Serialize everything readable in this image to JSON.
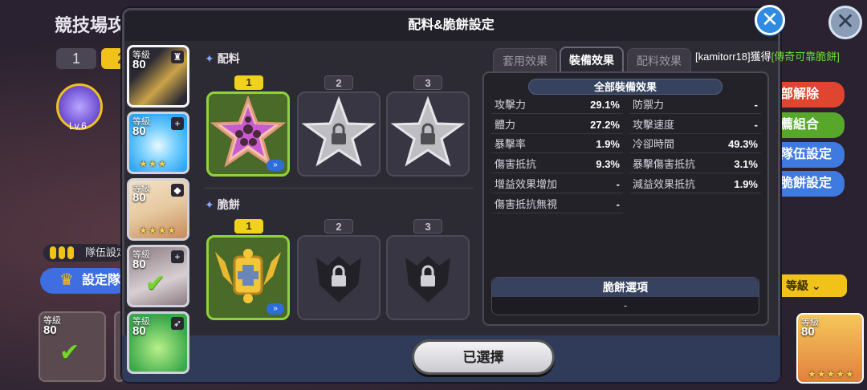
{
  "background": {
    "title": "競技場攻",
    "tabs": [
      "1",
      "2"
    ],
    "badge_level": "Lv.6",
    "team_label": "隊伍設定",
    "set_team_button": "設定隊",
    "right_buttons": [
      "部解除",
      "薦組合",
      "隊伍設定",
      "脆餅設定"
    ],
    "sort_label": "等級",
    "bottom_cookie_level_label": "等級",
    "bottom_cookie_level": "80",
    "close_icon": "close-icon"
  },
  "modal": {
    "title": "配料&脆餅設定",
    "close_label": "✕"
  },
  "cookies": [
    {
      "lv_label": "等級",
      "lv": "80",
      "icon": "sword-cookie",
      "colors": [
        "#2b2a33",
        "#caa34a"
      ],
      "badge": "team-icon"
    },
    {
      "lv_label": "等級",
      "lv": "80",
      "icon": "frost-cookie",
      "colors": [
        "#2fa6f0",
        "#e8f8ff"
      ],
      "stars": "★★★",
      "badge": "+"
    },
    {
      "lv_label": "等級",
      "lv": "80",
      "icon": "cream-cookie",
      "colors": [
        "#f4e2c8",
        "#c98a5a"
      ],
      "stars": "★★★★",
      "badge": "shield"
    },
    {
      "lv_label": "等級",
      "lv": "80",
      "icon": "knight-cookie",
      "colors": [
        "#8a7a80",
        "#d8cfd3"
      ],
      "check": "✔",
      "badge": "+"
    },
    {
      "lv_label": "等級",
      "lv": "80",
      "icon": "forest-cookie",
      "colors": [
        "#3aa84a",
        "#b8f08a"
      ],
      "badge": "arrow"
    }
  ],
  "toppings": {
    "title": "配料",
    "slots": [
      {
        "num": "1",
        "state": "equipped"
      },
      {
        "num": "2",
        "state": "locked"
      },
      {
        "num": "3",
        "state": "locked"
      }
    ]
  },
  "biscuit": {
    "title": "脆餅",
    "slots": [
      {
        "num": "1",
        "state": "equipped"
      },
      {
        "num": "2",
        "state": "locked"
      },
      {
        "num": "3",
        "state": "locked"
      }
    ]
  },
  "tabs": [
    "套用效果",
    "裝備效果",
    "配料效果"
  ],
  "acquire": {
    "user": "[kamitorr18]",
    "verb": "獲得",
    "item": "[傳奇可靠脆餅]"
  },
  "effects": {
    "header": "全部裝備效果",
    "left": [
      {
        "label": "攻擊力",
        "value": "29.1%"
      },
      {
        "label": "體力",
        "value": "27.2%"
      },
      {
        "label": "暴擊率",
        "value": "1.9%"
      },
      {
        "label": "傷害抵抗",
        "value": "9.3%"
      },
      {
        "label": "增益效果增加",
        "value": "-"
      },
      {
        "label": "傷害抵抗無視",
        "value": "-"
      }
    ],
    "right": [
      {
        "label": "防禦力",
        "value": "-"
      },
      {
        "label": "攻擊速度",
        "value": "-"
      },
      {
        "label": "冷卻時間",
        "value": "49.3%"
      },
      {
        "label": "暴擊傷害抵抗",
        "value": "3.1%"
      },
      {
        "label": "減益效果抵抗",
        "value": "1.9%"
      }
    ]
  },
  "cookie_option": {
    "title": "脆餅選項",
    "value": "-"
  },
  "footer": {
    "selected_button": "已選擇"
  }
}
